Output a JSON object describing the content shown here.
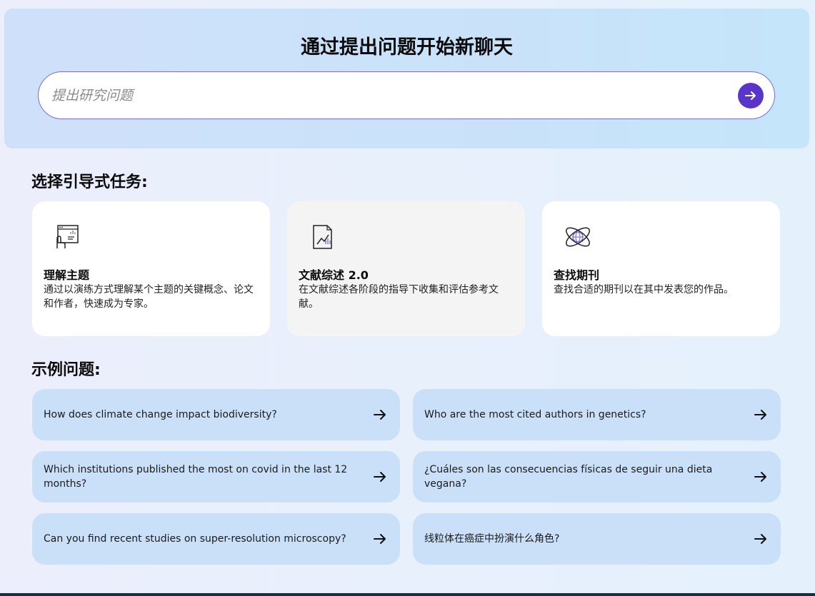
{
  "hero": {
    "title": "通过提出问题开始新聊天",
    "search_placeholder": "提出研究问题",
    "search_value": ""
  },
  "tasks_section": {
    "title": "选择引导式任务:",
    "cards": [
      {
        "icon": "presentation-icon",
        "title": "理解主题",
        "description": "通过以演练方式理解某个主题的关键概念、论文和作者，快速成为专家。"
      },
      {
        "icon": "document-chart-icon",
        "title": "文献综述 2.0",
        "description": "在文献综述各阶段的指导下收集和评估参考文献。"
      },
      {
        "icon": "globe-orbit-icon",
        "title": "查找期刊",
        "description": "查找合适的期刊以在其中发表您的作品。"
      }
    ]
  },
  "examples_section": {
    "title": "示例问题:",
    "items": [
      "How does climate change impact biodiversity?",
      "Who are the most cited authors in genetics?",
      "Which institutions published the most on covid in the last 12 months?",
      "¿Cuáles son las consecuencias físicas de seguir una dieta vegana?",
      "Can you find recent studies on super-resolution microscopy?",
      "线粒体在癌症中扮演什么角色?"
    ]
  },
  "colors": {
    "accent": "#5a35c9",
    "hero_bg": "#c9e2fa",
    "example_bg": "#c9e0f8"
  }
}
